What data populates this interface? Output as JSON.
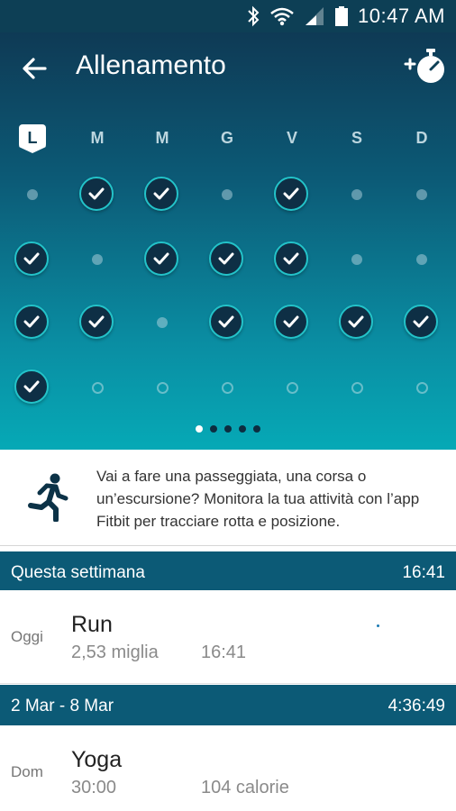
{
  "status_bar": {
    "time": "10:47 AM",
    "icons": [
      "bluetooth-icon",
      "wifi-icon",
      "signal-icon",
      "battery-icon"
    ]
  },
  "header": {
    "title": "Allenamento",
    "back_icon": "back-arrow-icon",
    "action_icon": "add-stopwatch-icon"
  },
  "calendar": {
    "days": [
      "L",
      "M",
      "M",
      "G",
      "V",
      "S",
      "D"
    ],
    "today_index": 0,
    "weeks": [
      [
        "dot",
        "check",
        "check",
        "dot",
        "check",
        "dot",
        "dot"
      ],
      [
        "check",
        "dot",
        "check",
        "check",
        "check",
        "dot",
        "dot"
      ],
      [
        "check",
        "check",
        "dot",
        "check",
        "check",
        "check",
        "check"
      ],
      [
        "check",
        "future",
        "future",
        "future",
        "future",
        "future",
        "future"
      ]
    ],
    "pages": 5,
    "active_page": 0
  },
  "promo": {
    "icon": "runner-icon",
    "text": "Vai a fare una passeggiata, una corsa o un’escursione? Monitora la tua attività con l’app Fitbit per tracciare rotta e posizione."
  },
  "sections": [
    {
      "title": "Questa settimana",
      "total": "16:41",
      "items": [
        {
          "day": "Oggi",
          "name": "Run",
          "value1": "2,53 miglia",
          "value2": "16:41"
        }
      ]
    },
    {
      "title": "2 Mar - 8 Mar",
      "total": "4:36:49",
      "items": [
        {
          "day": "Dom",
          "name": "Yoga",
          "value1": "30:00",
          "value2": "104 calorie"
        }
      ]
    }
  ],
  "colors": {
    "header_dark": "#0d3f55",
    "section_bar": "#0c5a76",
    "accent_teal": "#23c3c9",
    "check_fill": "#0e2f45"
  }
}
